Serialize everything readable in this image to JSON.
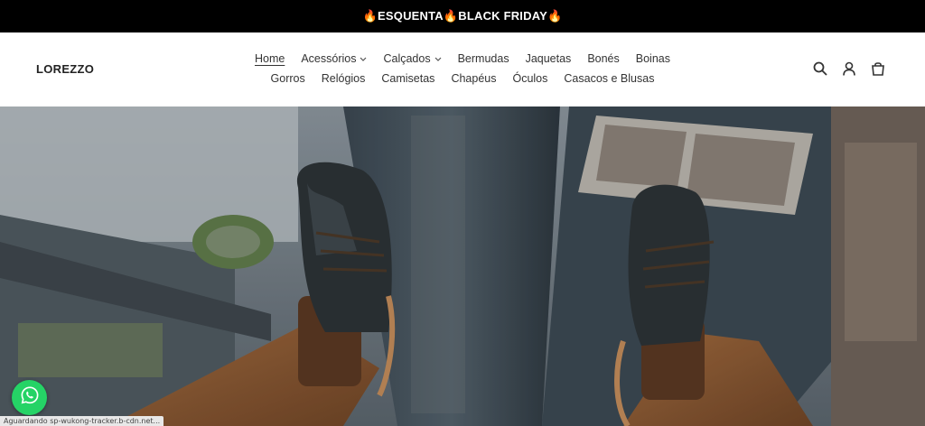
{
  "announcement": {
    "text": "🔥ESQUENTA🔥BLACK FRIDAY🔥"
  },
  "header": {
    "logo": "LOREZZO",
    "nav_row1": [
      {
        "label": "Home",
        "active": true,
        "dropdown": false
      },
      {
        "label": "Acessórios",
        "active": false,
        "dropdown": true
      },
      {
        "label": "Calçados",
        "active": false,
        "dropdown": true
      },
      {
        "label": "Bermudas",
        "active": false,
        "dropdown": false
      },
      {
        "label": "Jaquetas",
        "active": false,
        "dropdown": false
      },
      {
        "label": "Bonés",
        "active": false,
        "dropdown": false
      },
      {
        "label": "Boinas",
        "active": false,
        "dropdown": false
      }
    ],
    "nav_row2": [
      {
        "label": "Gorros"
      },
      {
        "label": "Relógios"
      },
      {
        "label": "Camisetas"
      },
      {
        "label": "Chapéus"
      },
      {
        "label": "Óculos"
      },
      {
        "label": "Casacos e Blusas"
      }
    ],
    "icons": [
      "search-icon",
      "account-icon",
      "cart-icon"
    ]
  },
  "colors": {
    "announcement_bg": "#000000",
    "whatsapp": "#25d366"
  },
  "status_bar": {
    "text": "Aguardando sp-wukong-tracker.b-cdn.net..."
  }
}
